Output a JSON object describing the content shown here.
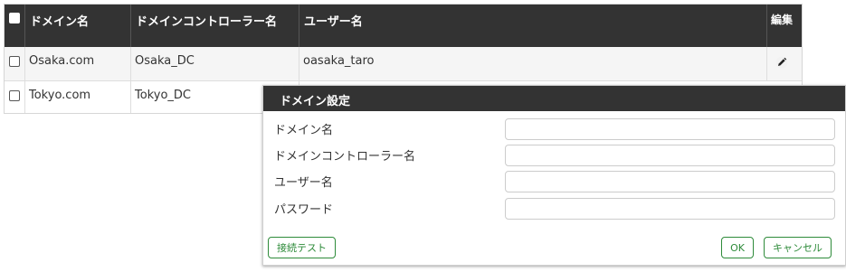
{
  "table": {
    "headers": {
      "domain": "ドメイン名",
      "controller": "ドメインコントローラー名",
      "user": "ユーザー名",
      "edit": "編集"
    },
    "rows": [
      {
        "domain": "Osaka.com",
        "controller": "Osaka_DC",
        "user": "oasaka_taro"
      },
      {
        "domain": "Tokyo.com",
        "controller": "Tokyo_DC",
        "user": ""
      }
    ]
  },
  "dialog": {
    "title": "ドメイン設定",
    "fields": [
      {
        "label": "ドメイン名",
        "value": ""
      },
      {
        "label": "ドメインコントローラー名",
        "value": ""
      },
      {
        "label": "ユーザー名",
        "value": ""
      },
      {
        "label": "パスワード",
        "value": ""
      }
    ],
    "buttons": {
      "test": "接続テスト",
      "ok": "OK",
      "cancel": "キャンセル"
    }
  },
  "icons": {
    "edit": "pencil-icon"
  },
  "colors": {
    "header_bg": "#333333",
    "button_accent": "#2e8b3a",
    "row_alt": "#f5f5f5"
  }
}
